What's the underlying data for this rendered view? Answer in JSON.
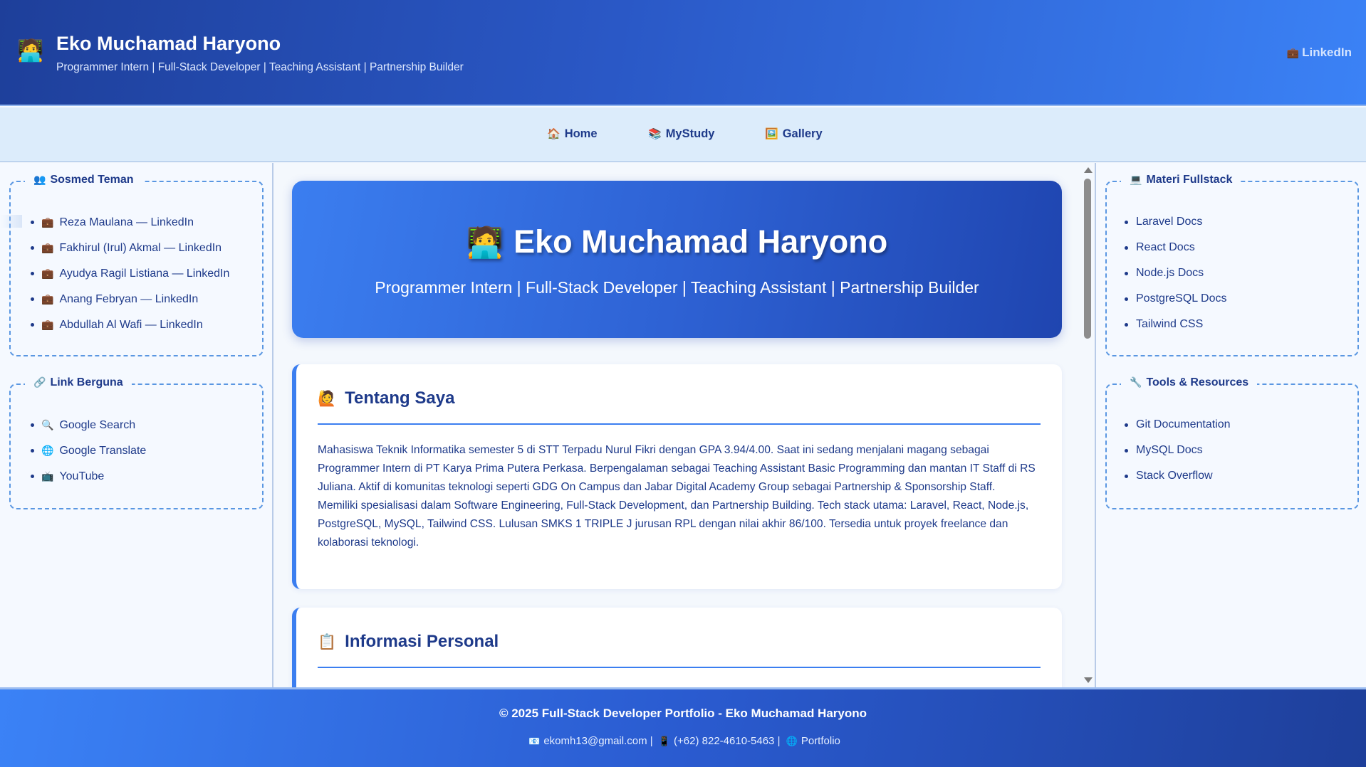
{
  "header": {
    "logo_emoji": "🧑‍💻",
    "title": "Eko Muchamad Haryono",
    "subtitle": "Programmer Intern | Full-Stack Developer | Teaching Assistant | Partnership Builder",
    "linkedin_icon": "💼",
    "linkedin_label": "LinkedIn"
  },
  "nav": {
    "items": [
      {
        "icon": "🏠",
        "label": "Home"
      },
      {
        "icon": "📚",
        "label": "MyStudy"
      },
      {
        "icon": "🖼️",
        "label": "Gallery"
      }
    ]
  },
  "left_sidebar": {
    "sosmed": {
      "icon": "👥",
      "title": "Sosmed Teman",
      "items": [
        {
          "icon": "💼",
          "label": "Reza Maulana — LinkedIn"
        },
        {
          "icon": "💼",
          "label": "Fakhirul (Irul) Akmal — LinkedIn"
        },
        {
          "icon": "💼",
          "label": "Ayudya Ragil Listiana — LinkedIn"
        },
        {
          "icon": "💼",
          "label": "Anang Febryan — LinkedIn"
        },
        {
          "icon": "💼",
          "label": "Abdullah Al Wafi — LinkedIn"
        }
      ]
    },
    "links": {
      "icon": "🔗",
      "title": "Link Berguna",
      "items": [
        {
          "icon": "🔍",
          "label": "Google Search"
        },
        {
          "icon": "🌐",
          "label": "Google Translate"
        },
        {
          "icon": "📺",
          "label": "YouTube"
        }
      ]
    }
  },
  "right_sidebar": {
    "materi": {
      "icon": "💻",
      "title": "Materi Fullstack",
      "items": [
        "Laravel Docs",
        "React Docs",
        "Node.js Docs",
        "PostgreSQL Docs",
        "Tailwind CSS"
      ]
    },
    "tools": {
      "icon": "🔧",
      "title": "Tools & Resources",
      "items": [
        "Git Documentation",
        "MySQL Docs",
        "Stack Overflow"
      ]
    }
  },
  "hero": {
    "icon": "🧑‍💻",
    "title": "Eko Muchamad Haryono",
    "subtitle": "Programmer Intern | Full-Stack Developer | Teaching Assistant | Partnership Builder"
  },
  "about": {
    "icon": "🙋",
    "title": "Tentang Saya",
    "paragraph1": "Mahasiswa Teknik Informatika semester 5 di STT Terpadu Nurul Fikri dengan GPA 3.94/4.00. Saat ini sedang menjalani magang sebagai Programmer Intern di PT Karya Prima Putera Perkasa. Berpengalaman sebagai Teaching Assistant Basic Programming dan mantan IT Staff di RS Juliana. Aktif di komunitas teknologi seperti GDG On Campus dan Jabar Digital Academy Group sebagai Partnership & Sponsorship Staff.",
    "paragraph2": "Memiliki spesialisasi dalam Software Engineering, Full-Stack Development, dan Partnership Building. Tech stack utama: Laravel, React, Node.js, PostgreSQL, MySQL, Tailwind CSS. Lulusan SMKS 1 TRIPLE J jurusan RPL dengan nilai akhir 86/100. Tersedia untuk proyek freelance dan kolaborasi teknologi."
  },
  "personal": {
    "icon": "📋",
    "title": "Informasi Personal"
  },
  "footer": {
    "copyright": "© 2025 Full-Stack Developer Portfolio - Eko Muchamad Haryono",
    "email_icon": "📧",
    "email": "ekomh13@gmail.com",
    "phone_icon": "📱",
    "phone": "(+62) 822-4610-5463",
    "portfolio_icon": "🌐",
    "portfolio": "Portfolio",
    "separator": "|"
  },
  "colors": {
    "primary_dark": "#1e3a8a",
    "primary": "#3b7ef0",
    "nav_bg": "#dcecfb",
    "dashed_border": "#5a97e2"
  }
}
